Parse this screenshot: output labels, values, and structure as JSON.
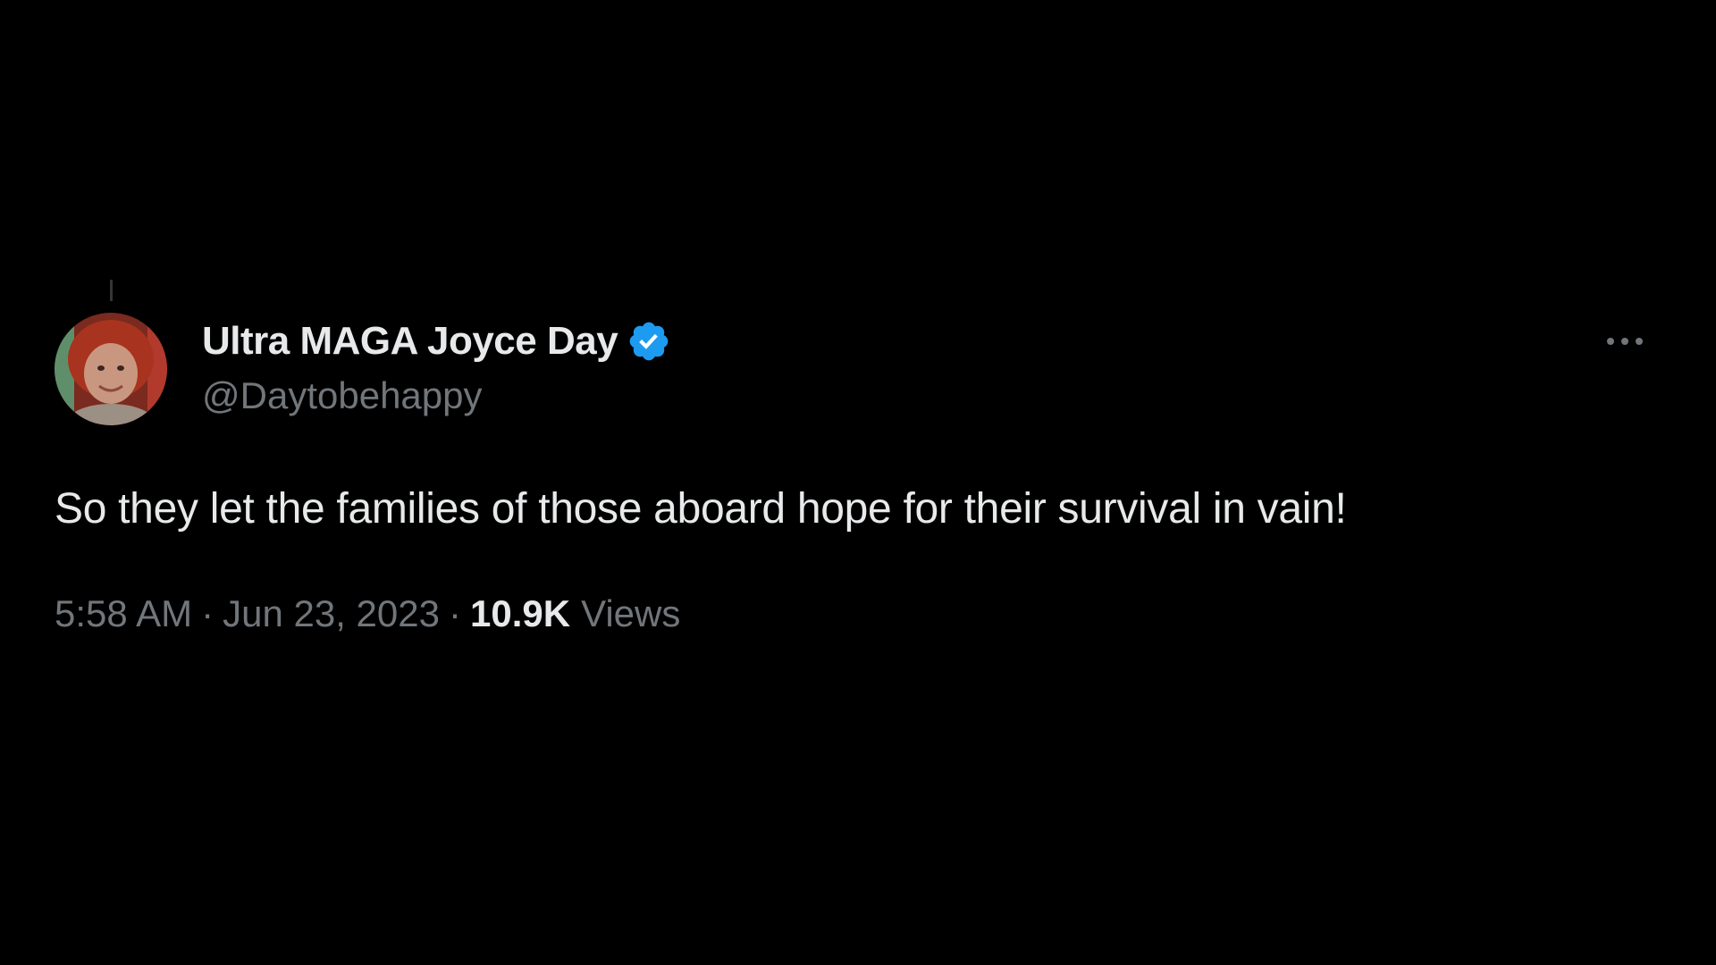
{
  "tweet": {
    "author": {
      "display_name": "Ultra MAGA Joyce Day",
      "handle": "@Daytobehappy",
      "verified": true,
      "avatar_icon": "profile-photo"
    },
    "text": "So they let the families of those aboard hope for their survival in vain!",
    "meta": {
      "time": "5:58 AM",
      "separator": "·",
      "date": "Jun 23, 2023",
      "views_count": "10.9K",
      "views_label": "Views"
    },
    "more_icon": "ellipsis-icon"
  },
  "colors": {
    "background": "#000000",
    "primary_text": "#e7e9ea",
    "secondary_text": "#71767b",
    "verified_badge": "#1d9bf0"
  }
}
